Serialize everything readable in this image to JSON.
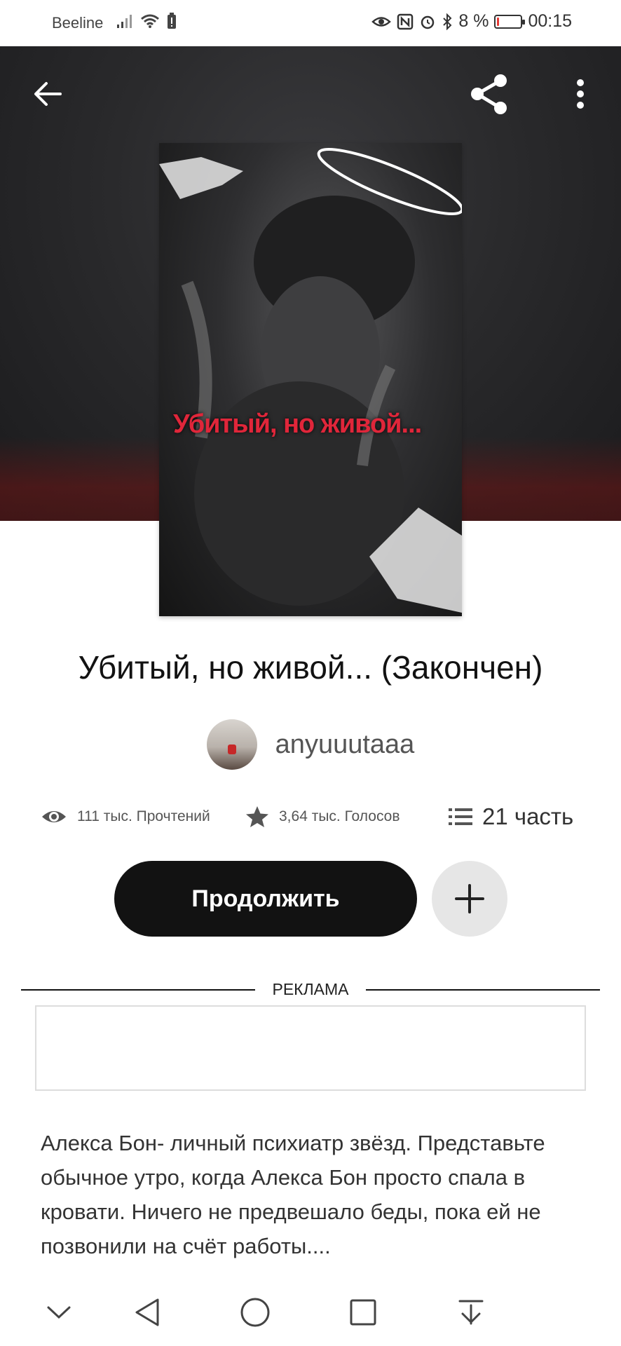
{
  "status_bar": {
    "carrier": "Beeline",
    "battery_text": "8 %",
    "battery_level": 0.08,
    "time": "00:15"
  },
  "toolbar": {
    "back_icon": "arrow-left-icon",
    "share_icon": "share-icon",
    "menu_icon": "more-vertical-icon"
  },
  "cover": {
    "title_text": "Убитый, но живой..."
  },
  "book": {
    "title": "Убитый, но живой... (Закончен)",
    "author": "anyuuutaaa"
  },
  "stats": {
    "reads": "111 тыс. Прочтений",
    "votes": "3,64 тыс. Голосов",
    "parts": "21 часть"
  },
  "actions": {
    "continue_label": "Продолжить",
    "add_icon": "plus-icon"
  },
  "ad": {
    "label": "РЕКЛАМА"
  },
  "description": "Алекса Бон- личный психиатр звёзд. Представьте обычное утро, когда Алекса Бон просто спала в кровати. Ничего не предвешало беды, пока ей не позвонили на счёт работы....",
  "navbar": {
    "icons": [
      "chevron-down-icon",
      "back-triangle-icon",
      "home-circle-icon",
      "recents-square-icon",
      "download-icon"
    ]
  }
}
